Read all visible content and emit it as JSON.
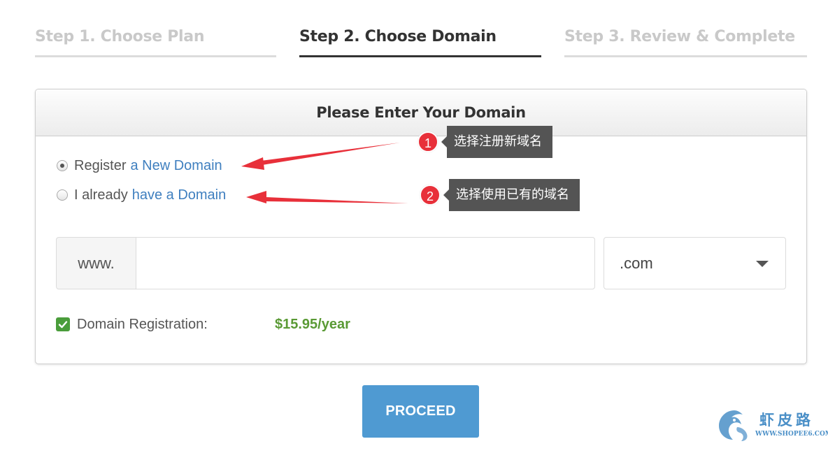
{
  "steps": [
    {
      "label": "Step 1. Choose Plan",
      "active": false
    },
    {
      "label": "Step 2. Choose Domain",
      "active": true
    },
    {
      "label": "Step 3. Review & Complete",
      "active": false
    }
  ],
  "panel": {
    "title": "Please Enter Your Domain",
    "options": [
      {
        "prefix": "Register",
        "link": "a New Domain",
        "selected": true
      },
      {
        "prefix": "I already",
        "link": "have a Domain",
        "selected": false
      }
    ],
    "domain": {
      "prefix": "www.",
      "value": "",
      "placeholder": "",
      "tld": ".com"
    },
    "registration": {
      "checked": true,
      "label": "Domain Registration:",
      "price": "$15.95/year"
    }
  },
  "proceed_label": "PROCEED",
  "annotations": [
    {
      "number": "1",
      "text": "选择注册新域名"
    },
    {
      "number": "2",
      "text": "选择使用已有的域名"
    }
  ],
  "watermark": {
    "text": "虾皮路",
    "url": "WWW.SHOPEE6.COM"
  },
  "colors": {
    "link": "#3f7fbf",
    "price": "#5a9a35",
    "button": "#4f9ad2",
    "annotation_badge": "#e8303a",
    "arrow": "#e8303a"
  }
}
